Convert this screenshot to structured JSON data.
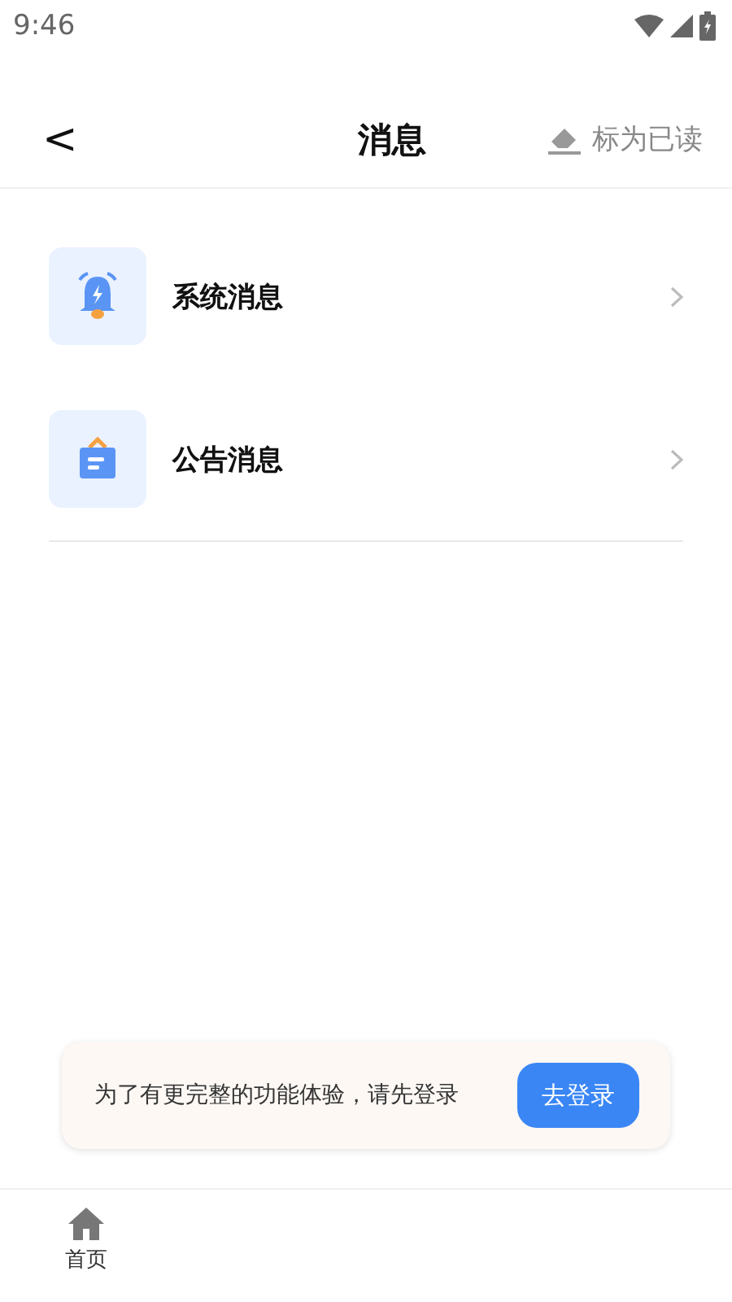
{
  "status_bar": {
    "time": "9:46"
  },
  "header": {
    "back": "<",
    "title": "消息",
    "action": "标为已读"
  },
  "items": [
    {
      "kind": "system",
      "label": "系统消息"
    },
    {
      "kind": "notice",
      "label": "公告消息"
    }
  ],
  "login_banner": {
    "text": "为了有更完整的功能体验，请先登录",
    "button": "去登录"
  },
  "tab_bar": [
    {
      "kind": "home",
      "label": "首页"
    }
  ]
}
